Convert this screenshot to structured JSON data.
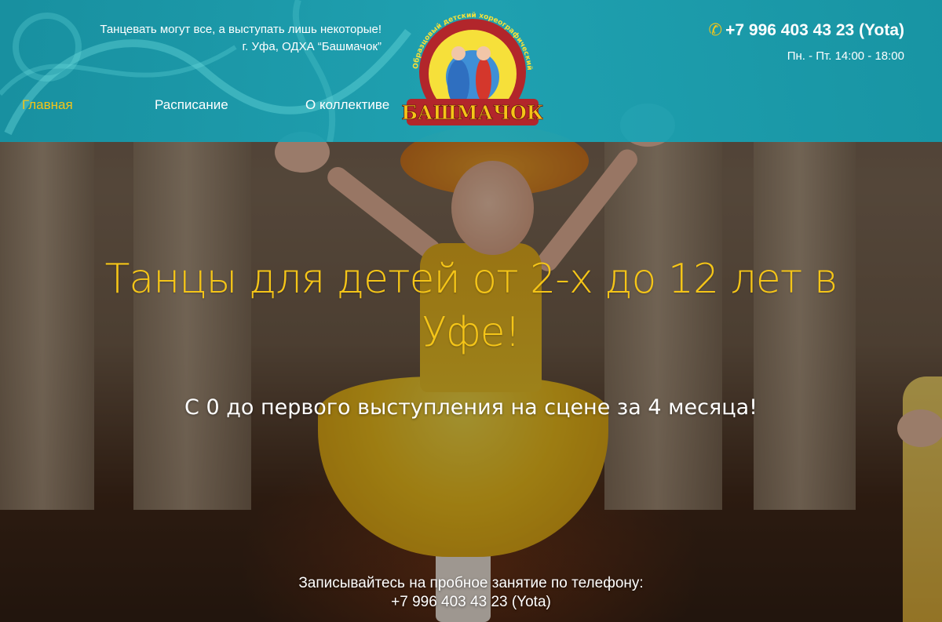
{
  "header": {
    "tagline_line1": "Танцевать могут все, а выступать лишь некоторые!",
    "tagline_line2": "г. Уфа, ОДХА “Башмачок”",
    "logo_text": "БАШМАЧОК",
    "logo_arc_text": "Образцовый детский хореографический ансамбль",
    "phone": "+7 996 403 43 23 (Yota)",
    "hours": "Пн. - Пт. 14:00 - 18:00"
  },
  "nav": {
    "items": [
      {
        "label": "Главная",
        "active": true
      },
      {
        "label": "Расписание",
        "active": false
      },
      {
        "label": "О коллективе",
        "active": false
      }
    ]
  },
  "hero": {
    "title_line1": "Танцы для детей от 2-х до 12 лет в",
    "title_line2": "Уфе!",
    "subtitle": "С 0 до первого выступления на сцене за 4 месяца!",
    "cta_line1": "Записывайтесь на пробное занятие по телефону:",
    "cta_line2": "+7 996 403 43 23 (Yota)"
  },
  "colors": {
    "header_teal": "#1ca8ba",
    "accent_yellow": "#f5c518",
    "text_white": "#ffffff"
  },
  "icons": {
    "phone": "phone-icon"
  }
}
